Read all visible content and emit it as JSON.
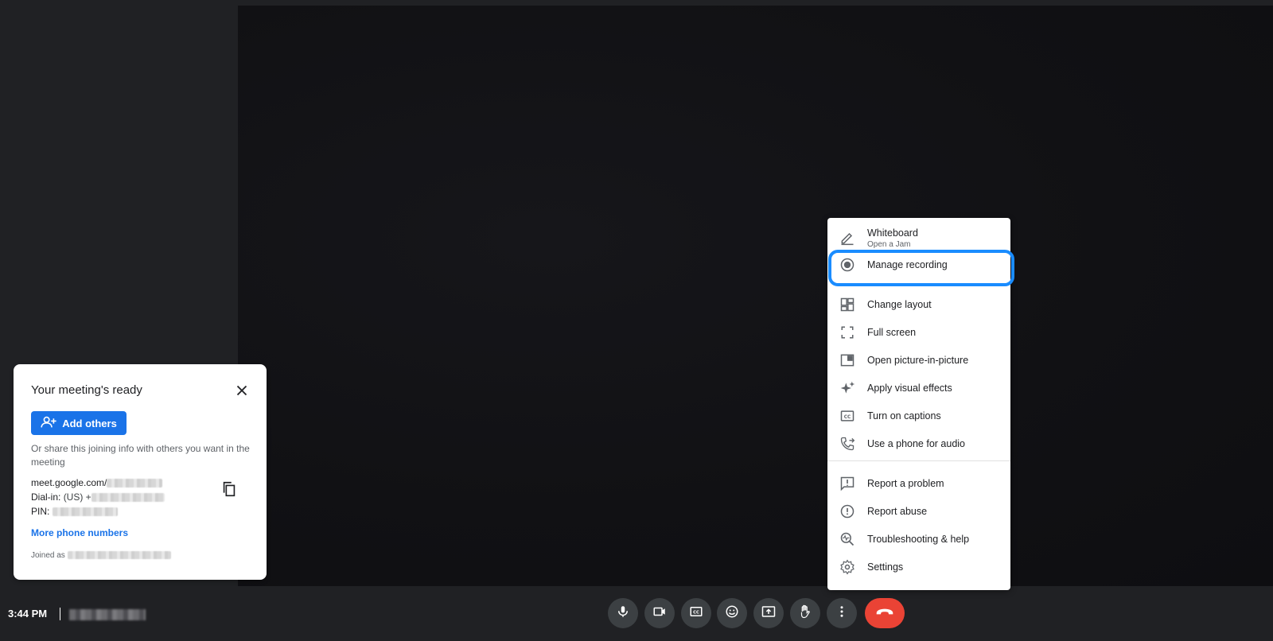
{
  "meeting_card": {
    "title": "Your meeting's ready",
    "add_others_label": "Add others",
    "share_text": "Or share this joining info with others you want in the meeting",
    "meet_link_prefix": "meet.google.com/",
    "dial_in_label": "Dial-in:",
    "dial_in_prefix": "(US) +",
    "pin_label": "PIN:",
    "more_numbers": "More phone numbers",
    "joined_as": "Joined as"
  },
  "menu": {
    "items": [
      {
        "label": "Whiteboard",
        "sub": "Open a Jam",
        "icon": "pencil-icon"
      },
      {
        "label": "Manage recording",
        "icon": "record-icon"
      },
      {
        "label": "Change layout",
        "icon": "layout-icon"
      },
      {
        "label": "Full screen",
        "icon": "fullscreen-icon"
      },
      {
        "label": "Open picture-in-picture",
        "icon": "pip-icon"
      },
      {
        "label": "Apply visual effects",
        "icon": "sparkle-icon"
      },
      {
        "label": "Turn on captions",
        "icon": "captions-icon"
      },
      {
        "label": "Use a phone for audio",
        "icon": "phone-icon"
      },
      {
        "label": "Report a problem",
        "icon": "feedback-icon"
      },
      {
        "label": "Report abuse",
        "icon": "alert-icon"
      },
      {
        "label": "Troubleshooting & help",
        "icon": "troubleshoot-icon"
      },
      {
        "label": "Settings",
        "icon": "gear-icon"
      }
    ]
  },
  "bottom_bar": {
    "time": "3:44 PM"
  },
  "colors": {
    "accent": "#1a73e8",
    "highlight": "#1a8cff",
    "hangup": "#ea4335",
    "control_bg": "#3c4043"
  }
}
